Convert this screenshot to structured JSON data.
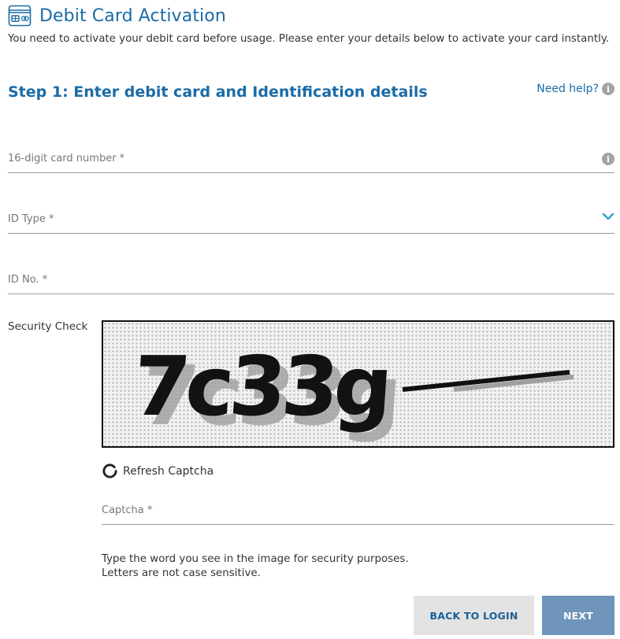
{
  "header": {
    "icon": "credit-card-icon",
    "title": "Debit Card Activation"
  },
  "intro_text": "You need to activate your debit card before usage. Please enter your details below to activate your card instantly.",
  "step": {
    "title": "Step 1: Enter debit card and Identification details",
    "help_label": "Need help?",
    "help_icon": "info-icon"
  },
  "form": {
    "card_number": {
      "placeholder": "16-digit card number *",
      "value": "",
      "icon": "info-icon"
    },
    "id_type": {
      "placeholder": "ID Type *",
      "value": "",
      "icon": "chevron-down-icon"
    },
    "id_no": {
      "placeholder": "ID No. *",
      "value": ""
    }
  },
  "security": {
    "label": "Security Check",
    "captcha_text": "7c33g",
    "refresh_icon": "refresh-icon",
    "refresh_label": "Refresh Captcha",
    "captcha_input": {
      "placeholder": "Captcha *",
      "value": ""
    },
    "hint_line1": "Type the word you see in the image for security purposes.",
    "hint_line2": "Letters are not case sensitive."
  },
  "buttons": {
    "back_label": "BACK TO LOGIN",
    "next_label": "NEXT"
  },
  "colors": {
    "brand_blue": "#1b6ba6",
    "chevron": "#2aa1d6",
    "next_button": "#6f95ba",
    "back_button": "#e3e3e3",
    "info_dot": "#a3a3a3"
  }
}
